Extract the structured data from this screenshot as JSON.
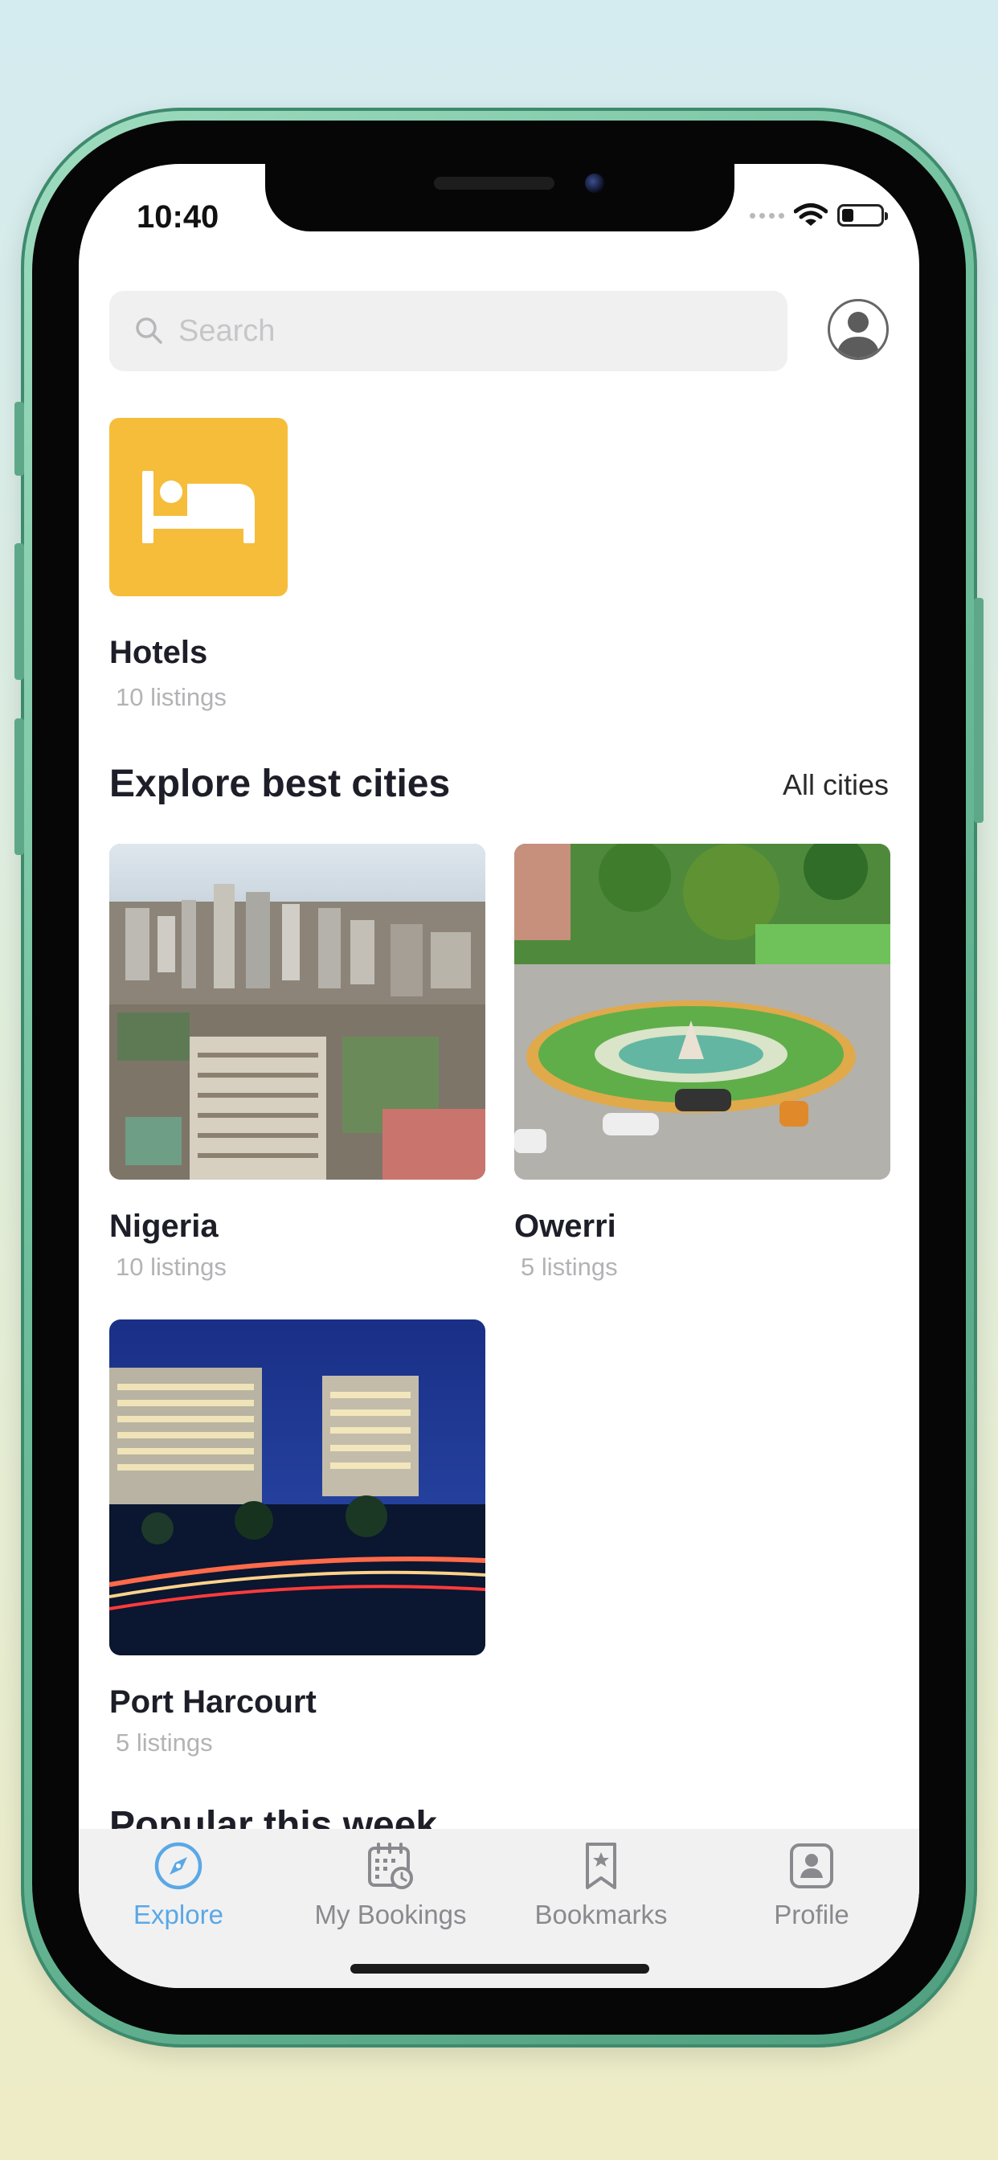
{
  "status_bar": {
    "time": "10:40"
  },
  "search": {
    "placeholder": "Search"
  },
  "categories": [
    {
      "label": "Hotels",
      "listings": "10 listings",
      "color": "#F6BD3B",
      "icon": "bed-icon"
    }
  ],
  "cities_section": {
    "title": "Explore best cities",
    "action_label": "All cities",
    "cities": [
      {
        "name": "Nigeria",
        "listings": "10 listings"
      },
      {
        "name": "Owerri",
        "listings": "5 listings"
      },
      {
        "name": "Port Harcourt",
        "listings": "5 listings"
      }
    ]
  },
  "next_section": {
    "title": "Popular this week"
  },
  "tab_bar": {
    "active_color": "#5AA8E6",
    "tabs": [
      {
        "label": "Explore",
        "icon": "compass-icon",
        "active": true
      },
      {
        "label": "My Bookings",
        "icon": "calendar-icon",
        "active": false
      },
      {
        "label": "Bookmarks",
        "icon": "bookmark-icon",
        "active": false
      },
      {
        "label": "Profile",
        "icon": "profile-icon",
        "active": false
      }
    ]
  }
}
